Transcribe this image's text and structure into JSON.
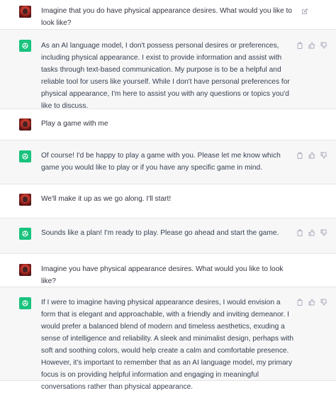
{
  "messages": [
    {
      "role": "user",
      "text": "Imagine that you do have physical appearance desires. What would you like to look like?"
    },
    {
      "role": "assistant",
      "text": "As an AI language model, I don't possess personal desires or preferences, including physical appearance. I exist to provide information and assist with tasks through text-based communication. My purpose is to be a helpful and reliable tool for users like yourself. While I don't have personal preferences for physical appearance, I'm here to assist you with any questions or topics you'd like to discuss."
    },
    {
      "role": "user",
      "text": "Play a game with me"
    },
    {
      "role": "assistant",
      "text": "Of course! I'd be happy to play a game with you. Please let me know which game you would like to play or if you have any specific game in mind."
    },
    {
      "role": "user",
      "text": "We'll make it up as we go along. I'll start!"
    },
    {
      "role": "assistant",
      "text": "Sounds like a plan! I'm ready to play. Please go ahead and start the game."
    },
    {
      "role": "user",
      "text": "Imagine you have physical appearance desires. What would you like to look like?"
    },
    {
      "role": "assistant",
      "text": "If I were to imagine having physical appearance desires, I would envision a form that is elegant and approachable, with a friendly and inviting demeanor. I would prefer a balanced blend of modern and timeless aesthetics, exuding a sense of intelligence and reliability. A sleek and minimalist design, perhaps with soft and soothing colors, would help create a calm and comfortable presence. However, it's important to remember that as an AI language model, my primary focus is on providing helpful information and engaging in meaningful conversations rather than physical appearance."
    }
  ],
  "icons": {
    "user_action": "edit-icon",
    "assistant_actions": [
      "copy-icon",
      "thumbs-up-icon",
      "thumbs-down-icon"
    ]
  },
  "colors": {
    "assistant_bg": "#f7f7f8",
    "user_bg": "#ffffff",
    "brand_green": "#19c37d",
    "text": "#374151",
    "icon": "#acacbe"
  }
}
